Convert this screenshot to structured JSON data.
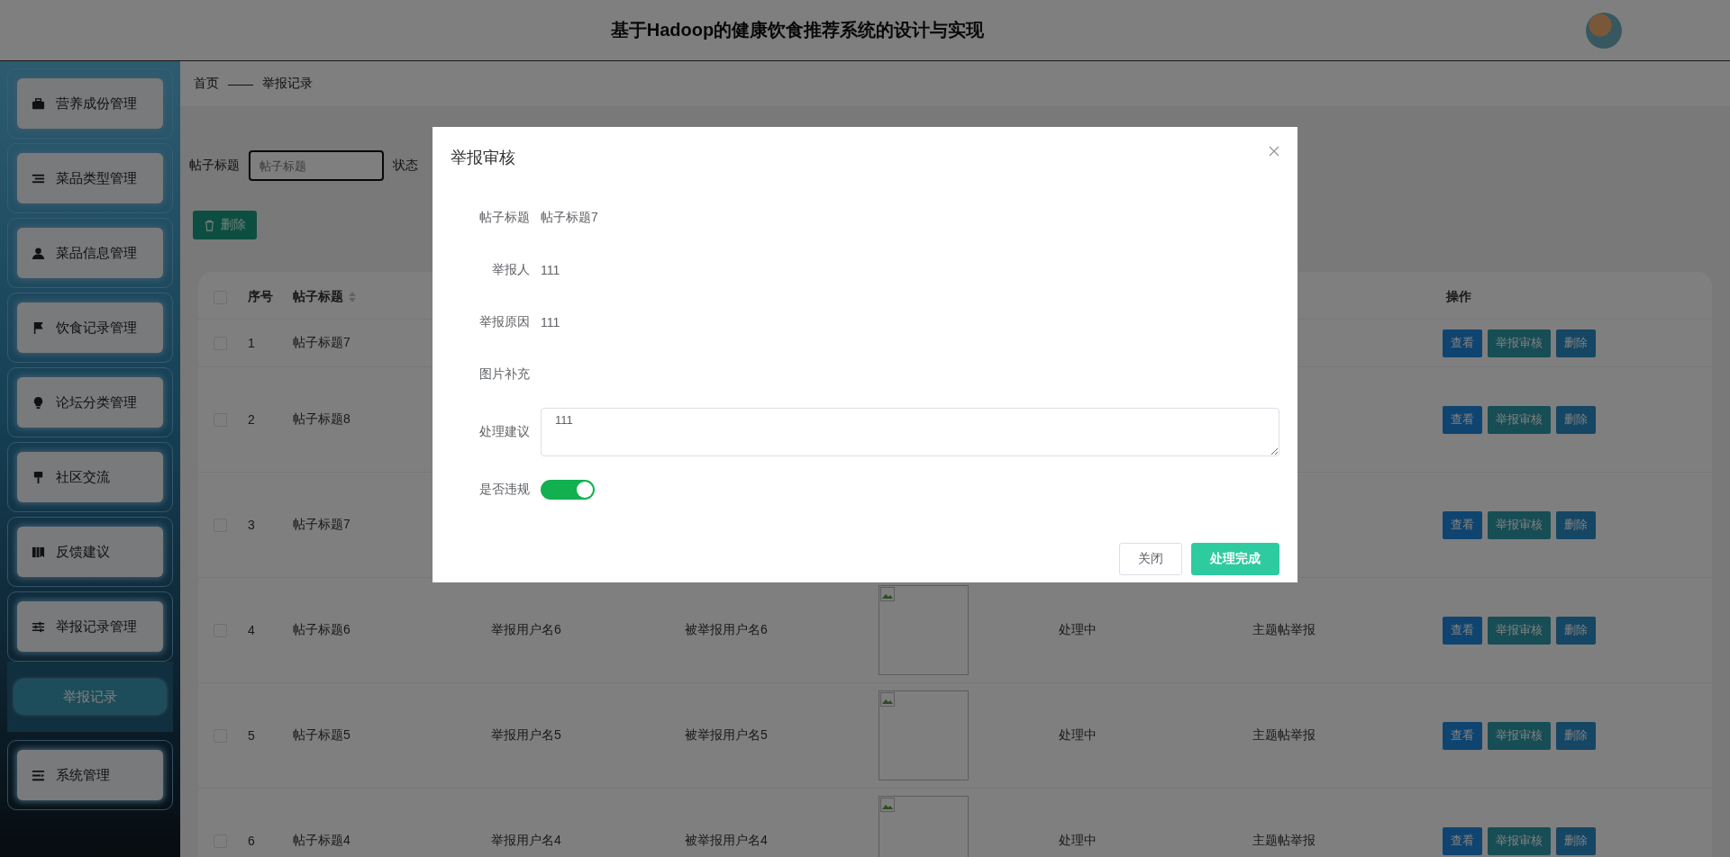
{
  "header": {
    "title": "基于Hadoop的健康饮食推荐系统的设计与实现"
  },
  "sidebar": {
    "items": [
      {
        "label": "营养成份管理"
      },
      {
        "label": "菜品类型管理"
      },
      {
        "label": "菜品信息管理"
      },
      {
        "label": "饮食记录管理"
      },
      {
        "label": "论坛分类管理"
      },
      {
        "label": "社区交流"
      },
      {
        "label": "反馈建议"
      },
      {
        "label": "举报记录管理",
        "children": [
          {
            "label": "举报记录",
            "selected": true
          }
        ]
      },
      {
        "label": "系统管理"
      }
    ]
  },
  "breadcrumb": [
    "首页",
    "举报记录"
  ],
  "breadcrumb_separator": "——",
  "filter": {
    "label": "帖子标题",
    "placeholder": "帖子标题",
    "status_label": "状态"
  },
  "delete_button": {
    "label": "删除"
  },
  "table": {
    "select_all": {
      "checked": false
    },
    "columns": [
      {
        "label": "序号"
      },
      {
        "label": "帖子标题",
        "sortable": true
      },
      {
        "label": "操作"
      }
    ],
    "rows": [
      {
        "checked": false,
        "index": "1",
        "title": "帖子标题7",
        "actions": [
          "查看",
          "举报审核",
          "删除"
        ]
      },
      {
        "checked": false,
        "index": "2",
        "title": "帖子标题8",
        "actions": [
          "查看",
          "举报审核",
          "删除"
        ]
      },
      {
        "checked": false,
        "index": "3",
        "title": "帖子标题7",
        "actions": [
          "查看",
          "举报审核",
          "删除"
        ]
      },
      {
        "checked": false,
        "index": "4",
        "title": "帖子标题6",
        "reporter": "举报用户名6",
        "reported": "被举报用户名6",
        "image": true,
        "status": "处理中",
        "type": "主题帖举报",
        "actions": [
          "查看",
          "举报审核",
          "删除"
        ]
      },
      {
        "checked": false,
        "index": "5",
        "title": "帖子标题5",
        "reporter": "举报用户名5",
        "reported": "被举报用户名5",
        "image": true,
        "status": "处理中",
        "type": "主题帖举报",
        "actions": [
          "查看",
          "举报审核",
          "删除"
        ]
      },
      {
        "checked": false,
        "index": "6",
        "title": "帖子标题4",
        "reporter": "举报用户名4",
        "reported": "被举报用户名4",
        "image": true,
        "status": "处理中",
        "type": "主题帖举报",
        "actions": [
          "查看",
          "举报审核",
          "删除"
        ]
      }
    ]
  },
  "dialog": {
    "title": "举报审核",
    "fields": [
      {
        "kind": "text",
        "label": "帖子标题",
        "value": "帖子标题7"
      },
      {
        "kind": "text",
        "label": "举报人",
        "value": "111"
      },
      {
        "kind": "text",
        "label": "举报原因",
        "value": "111"
      },
      {
        "kind": "image",
        "label": "图片补充"
      },
      {
        "kind": "textarea",
        "label": "处理建议",
        "value": "111"
      },
      {
        "kind": "switch",
        "label": "是否违规",
        "on": true
      }
    ],
    "buttons": [
      {
        "kind": "default",
        "label": "关闭"
      },
      {
        "kind": "primary",
        "label": "处理完成"
      }
    ]
  }
}
